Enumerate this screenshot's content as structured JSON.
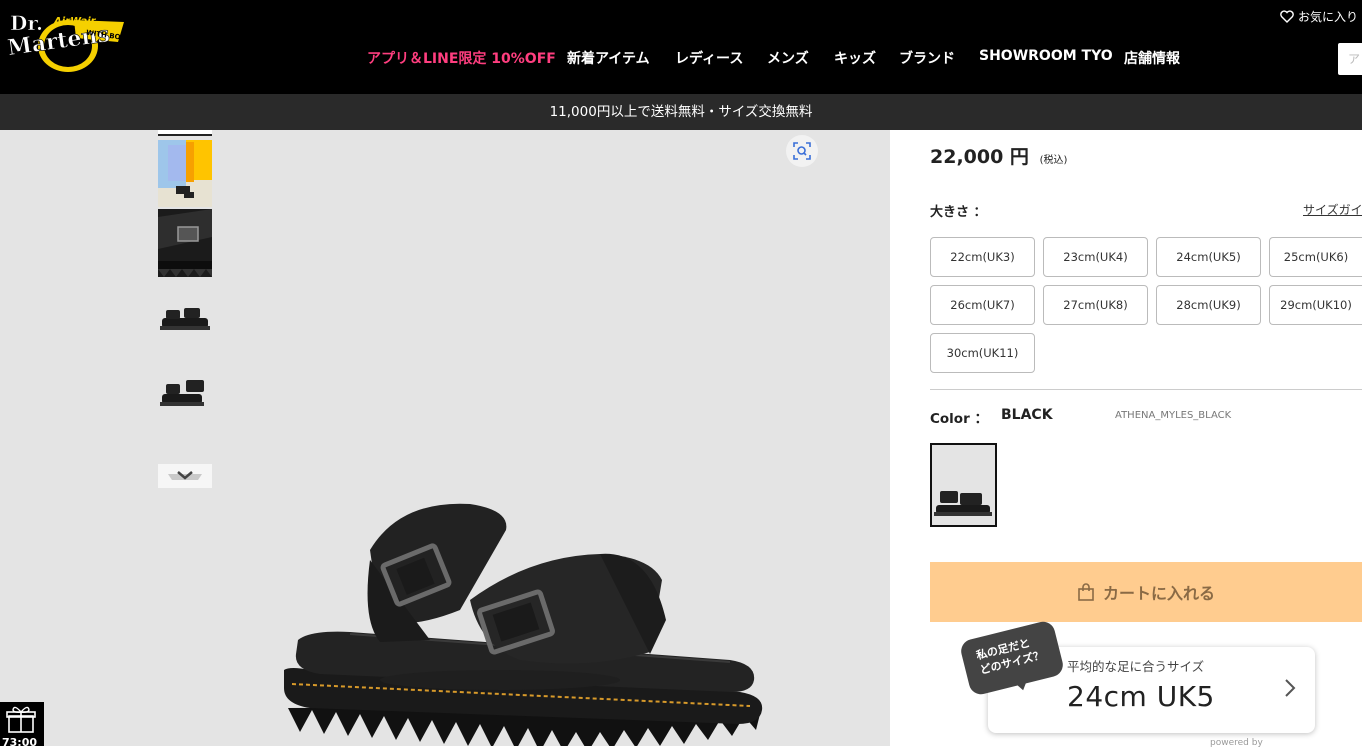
{
  "header": {
    "logo_text": "Dr. Martens AirWair",
    "favorites_label": "お気に入り",
    "search_placeholder": "ア",
    "nav": [
      {
        "label": "アプリ＆LINE限定 10%OFF",
        "promo": true
      },
      {
        "label": "新着アイテム"
      },
      {
        "label": "レディース"
      },
      {
        "label": "メンズ"
      },
      {
        "label": "キッズ"
      },
      {
        "label": "ブランド"
      },
      {
        "label": "SHOWROOM TYO"
      },
      {
        "label": "店舗情報"
      }
    ]
  },
  "notice": {
    "text": "11,000円以上で送料無料・サイズ交換無料"
  },
  "gallery": {
    "thumbnails": [
      "sandal-on-feet",
      "sandal-closeup",
      "sandal-pair-side",
      "sandal-pair-angle",
      "more-down"
    ],
    "zoom_icon": "zoom-scan-icon"
  },
  "product": {
    "price": "22,000 円",
    "price_note": "(税込)",
    "size_label": "大きさ ：",
    "size_guide_label": "サイズガイ",
    "sizes": [
      "22cm(UK3)",
      "23cm(UK4)",
      "24cm(UK5)",
      "25cm(UK6)",
      "26cm(UK7)",
      "27cm(UK8)",
      "28cm(UK9)",
      "29cm(UK10)",
      "30cm(UK11)"
    ],
    "color_label": "Color ：",
    "color_value": "BLACK",
    "color_code": "ATHENA_MYLES_BLACK",
    "cart_label": "カートに入れる"
  },
  "fit": {
    "bubble_line1": "私の足だと",
    "bubble_line2": "どのサイズ？",
    "caption": "平均的な足に合うサイズ",
    "size": "24cm UK5",
    "powered_by": "powered by"
  },
  "gift_widget": {
    "time": "73:00"
  },
  "colors": {
    "header_bg": "#000000",
    "promo": "#ff3e7f",
    "notice_bg": "#2a2a2a",
    "gallery_bg": "#e4e4e4",
    "cart_bg": "#ffcc8f"
  }
}
